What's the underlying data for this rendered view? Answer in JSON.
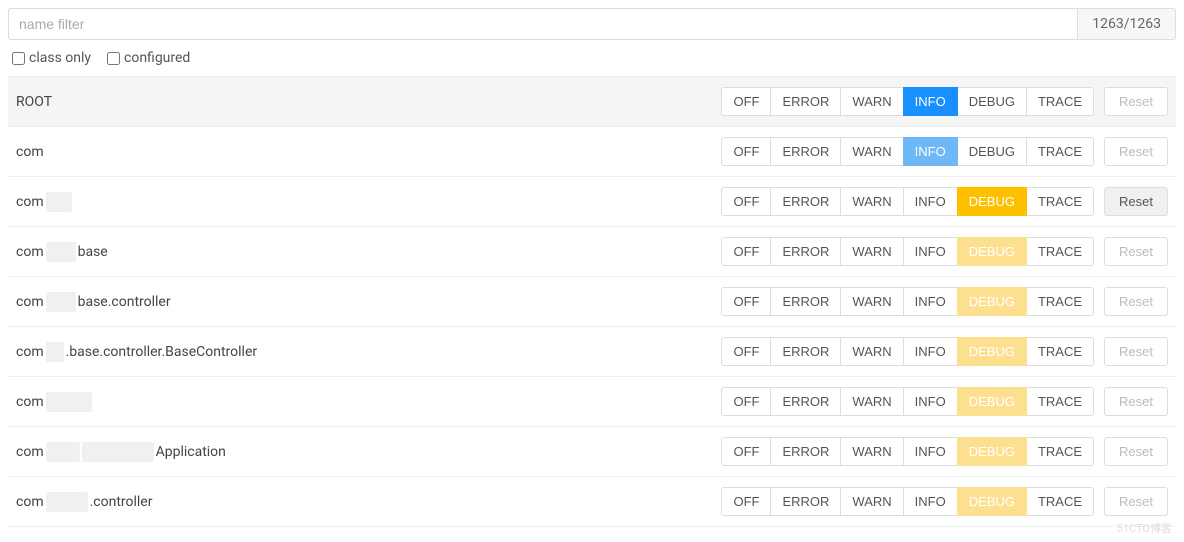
{
  "filter": {
    "placeholder": "name filter",
    "counter": "1263/1263"
  },
  "checkboxes": {
    "class_only": "class only",
    "configured": "configured"
  },
  "levels": {
    "off": "OFF",
    "error": "ERROR",
    "warn": "WARN",
    "info": "INFO",
    "debug": "DEBUG",
    "trace": "TRACE"
  },
  "reset_label": "Reset",
  "loggers": [
    {
      "name_a": "ROOT",
      "name_b": "",
      "name_c": "",
      "root": true,
      "active": "info-active",
      "reset": false,
      "r1w": 0,
      "r2w": 0
    },
    {
      "name_a": "com",
      "name_b": "",
      "name_c": "",
      "root": false,
      "active": "info-inherit",
      "reset": false,
      "r1w": 0,
      "r2w": 0
    },
    {
      "name_a": "com",
      "name_b": "",
      "name_c": "",
      "root": false,
      "active": "debug-active",
      "reset": true,
      "r1w": 26,
      "r2w": 0
    },
    {
      "name_a": "com",
      "name_b": "",
      "name_c": "base",
      "root": false,
      "active": "debug-inherit",
      "reset": false,
      "r1w": 30,
      "r2w": 0
    },
    {
      "name_a": "com",
      "name_b": "",
      "name_c": "base.controller",
      "root": false,
      "active": "debug-inherit",
      "reset": false,
      "r1w": 30,
      "r2w": 0
    },
    {
      "name_a": "com",
      "name_b": "",
      "name_c": ".base.controller.BaseController",
      "root": false,
      "active": "debug-inherit",
      "reset": false,
      "r1w": 18,
      "r2w": 0
    },
    {
      "name_a": "com",
      "name_b": "",
      "name_c": "",
      "root": false,
      "active": "debug-inherit",
      "reset": false,
      "r1w": 46,
      "r2w": 0
    },
    {
      "name_a": "com",
      "name_b": "",
      "name_c": "Application",
      "root": false,
      "active": "debug-inherit",
      "reset": false,
      "r1w": 34,
      "r2w": 72
    },
    {
      "name_a": "com",
      "name_b": "",
      "name_c": ".controller",
      "root": false,
      "active": "debug-inherit",
      "reset": false,
      "r1w": 42,
      "r2w": 0
    }
  ],
  "watermark": "51CTO博客"
}
